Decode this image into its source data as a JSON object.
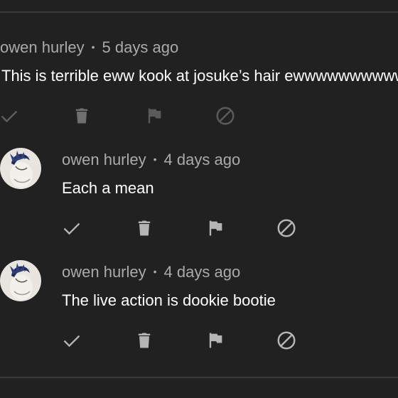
{
  "comments": [
    {
      "author": "owen hurley",
      "separator": "•",
      "time": "5 days ago",
      "text": "This is terrible eww kook at josuke’s hair ewwwwwwwwww",
      "has_avatar": false,
      "actions": {
        "approve_icon": "check-icon",
        "delete_icon": "trash-icon",
        "report_icon": "flag-icon",
        "block_icon": "block-icon"
      },
      "icon_color": "#6f6f6f"
    },
    {
      "author": "owen hurley",
      "separator": "•",
      "time": "4 days ago",
      "text": "Each a mean",
      "has_avatar": true,
      "actions": {
        "approve_icon": "check-icon",
        "delete_icon": "trash-icon",
        "report_icon": "flag-icon",
        "block_icon": "block-icon"
      },
      "icon_color": "#b5b5b5"
    },
    {
      "author": "owen hurley",
      "separator": "•",
      "time": "4 days ago",
      "text": "The live action is dookie bootie",
      "has_avatar": true,
      "actions": {
        "approve_icon": "check-icon",
        "delete_icon": "trash-icon",
        "report_icon": "flag-icon",
        "block_icon": "block-icon"
      },
      "icon_color": "#b5b5b5"
    }
  ],
  "colors": {
    "background": "#212121",
    "meta_text": "#aaaaaa",
    "body_text": "#ffffff",
    "divider": "#3a3a3a"
  }
}
